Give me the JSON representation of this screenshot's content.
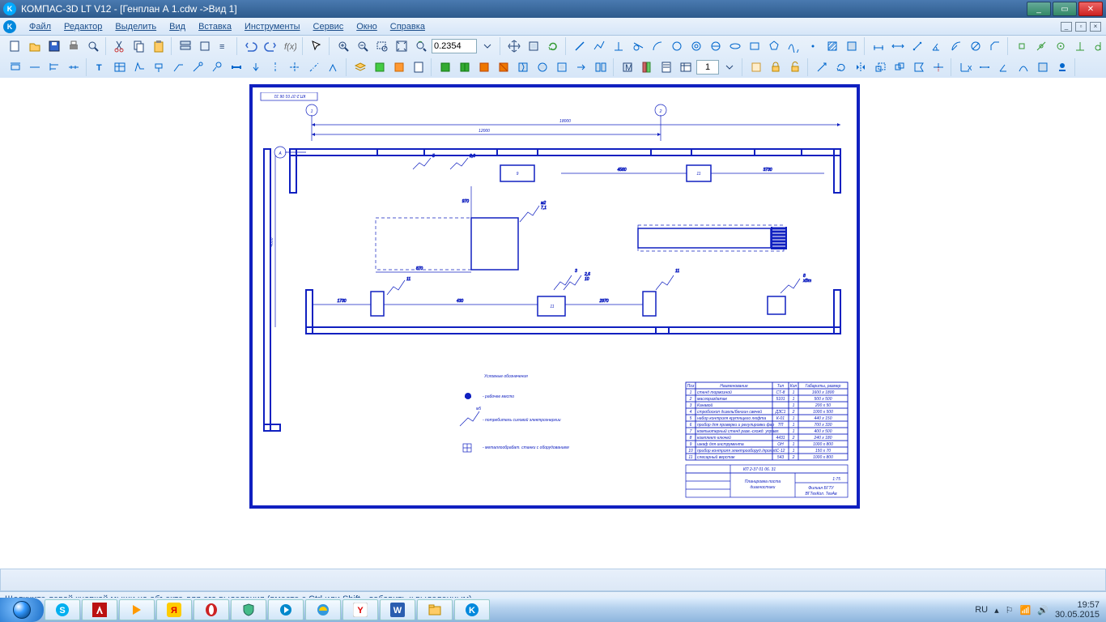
{
  "title": "КОМПАС-3D LT V12 - [Генплан А 1.cdw ->Вид 1]",
  "menu": [
    "Файл",
    "Редактор",
    "Выделить",
    "Вид",
    "Вставка",
    "Инструменты",
    "Сервис",
    "Окно",
    "Справка"
  ],
  "zoom": "0.2354",
  "page": "1",
  "status": "Щелкните левой кнопкой мыши на объекте для его выделения (вместе с Ctrl или Shift - добавить к выделенным)",
  "tray": {
    "lang": "RU",
    "time": "19:57",
    "date": "30.05.2015"
  },
  "drawing": {
    "code_top": "КП 2-37 01 06 31",
    "code_stamp": "КП 2-37 01 06. 31",
    "title_stamp": "Планировка поста\nдиагностики",
    "school1": "Филиал БГТУ",
    "school2": "ВГТехКол. ТехАв",
    "legend_title": "Условные обозначения",
    "legend_items": [
      "- рабочее место",
      "- потребитель силовой электроэнергии",
      "- металлообрабат. станки с оборудованием"
    ],
    "dims": {
      "total": "18000",
      "g1": "12000",
      "d1": "4560",
      "d2": "3730",
      "d3": "1730",
      "d4": "430",
      "d5": "2970",
      "h": "4000",
      "w3": "970",
      "w4": "870"
    },
    "grid_marks": [
      "1",
      "2",
      "А"
    ],
    "table": {
      "header": [
        "Поз",
        "Наименование",
        "Тип",
        "Кол",
        "Габариты, размер"
      ],
      "rows": [
        [
          "1",
          "стенд тормозной",
          "СТ-8",
          "1",
          "1600 х 1800"
        ],
        [
          "2",
          "маслораздатак",
          "5101",
          "1",
          "500 х 500"
        ],
        [
          "3",
          "Канавой",
          "",
          "1",
          "200 х 50"
        ],
        [
          "4",
          "стробоскоп дизель/бензин свечей",
          "ДЗС1",
          "2",
          "1000 х 500"
        ],
        [
          "5",
          "набор контроля крутящего люфта",
          "К-01",
          "1",
          "440 х 150"
        ],
        [
          "6",
          "прибор дпя проверки и регулировки фар",
          "ТП",
          "1",
          "700 х 330"
        ],
        [
          "7",
          "компьютерный стенд разв.-схожд. управл.",
          "",
          "1",
          "400 х 500"
        ],
        [
          "8",
          "комплект ключей",
          "4431",
          "2",
          "240 x 180"
        ],
        [
          "9",
          "шкаф для инструмента",
          "ОН",
          "1",
          "1000 х 800"
        ],
        [
          "10",
          "прибор контроля электрооборуд./проход.",
          "С-12",
          "1",
          "150 х 70"
        ],
        [
          "11",
          "слесарный верстак",
          "543",
          "2",
          "1000 х 800"
        ]
      ]
    }
  }
}
